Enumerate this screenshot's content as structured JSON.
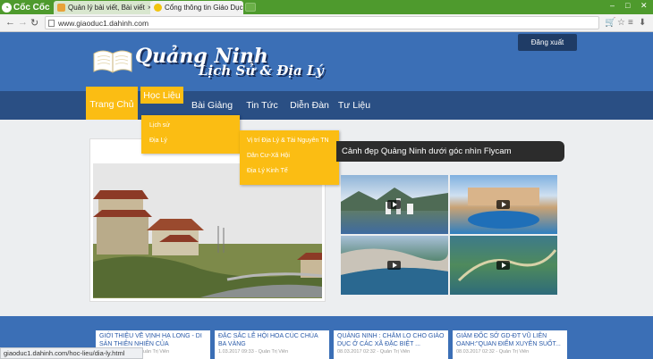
{
  "browser": {
    "brand": "Cốc Cốc",
    "tabs": [
      {
        "title": "Quản lý bài viết, Bài viết",
        "close": "×"
      },
      {
        "title": "Cổng thông tin Giáo Dục",
        "close": "×"
      }
    ],
    "url": "www.giaoduc1.dahinh.com",
    "status_url": "giaoduc1.dahinh.com/hoc-lieu/dia-ly.html"
  },
  "site": {
    "logout_label": "Đăng xuất",
    "logo_title": "Quảng Ninh",
    "logo_subtitle": "Lịch Sử & Địa Lý"
  },
  "nav": {
    "items": [
      "Trang Chủ",
      "Học Liệu",
      "Bài Giảng",
      "Tin Tức",
      "Diễn Đàn",
      "Tư Liệu"
    ],
    "dropdown_level1": [
      "Lịch sử",
      "Địa Lý"
    ],
    "dropdown_level2": [
      "Vị trí Địa Lý & Tài Nguyên TN",
      "Dân Cư-Xã Hội",
      "Địa Lý Kinh Tế"
    ]
  },
  "videos": {
    "title": "Cảnh đẹp Quảng Ninh dưới góc nhìn Flycam",
    "count": 4
  },
  "news": [
    {
      "title": "GIỚI THIỆU VỀ VỊNH HẠ LONG - DI SẢN THIÊN NHIÊN CỦA",
      "meta": "1.03.2017 09:33 - Quản Trị Viên"
    },
    {
      "title": "ĐẶC SẮC LỄ HỘI HOA CÚC CHÙA BA VÀNG",
      "meta": "1.03.2017 09:33 - Quản Trị Viên"
    },
    {
      "title": "QUẢNG NINH : CHĂM LO CHO GIÁO DỤC Ở CÁC XÃ ĐẶC BIỆT ...",
      "meta": "08.03.2017 02:32 - Quản Trị Viên"
    },
    {
      "title": "GIÁM ĐỐC SỞ GD-ĐT VŨ LIÊN OANH:\"QUAN ĐIỂM XUYÊN SUỐT...",
      "meta": "08.03.2017 02:32 - Quản Trị Viên"
    }
  ],
  "colors": {
    "accent": "#fbbd13",
    "header": "#3b6fb6",
    "nav": "#2a4f84",
    "browser": "#4e9a2d"
  }
}
